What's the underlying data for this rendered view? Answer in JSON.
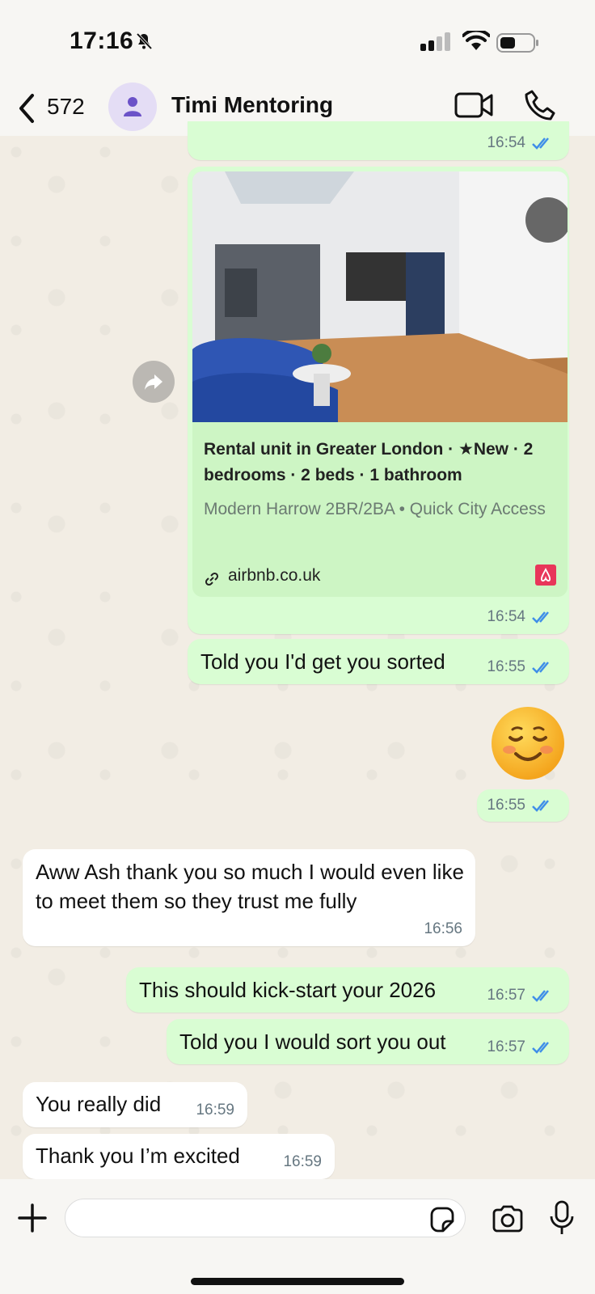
{
  "status_bar": {
    "time": "17:16"
  },
  "header": {
    "back_count": "572",
    "contact_name": "Timi Mentoring"
  },
  "messages": {
    "m0": {
      "time": "16:54"
    },
    "link": {
      "title": "Rental unit in Greater London · ★New · 2 bedrooms · 2 beds · 1 bathroom",
      "description": "Modern Harrow 2BR/2BA • Quick City Access",
      "domain": "airbnb.co.uk",
      "time": "16:54"
    },
    "m2": {
      "text": "Told you I'd get you sorted",
      "time": "16:55"
    },
    "m3": {
      "emoji": "☺️",
      "time": "16:55"
    },
    "m4": {
      "text": "Aww Ash thank you so much I would even like to meet them so they trust me fully",
      "time": "16:56"
    },
    "m5": {
      "text": "This should kick-start your 2026",
      "time": "16:57"
    },
    "m6": {
      "text": "Told you I would sort you out",
      "time": "16:57"
    },
    "m7": {
      "text": "You really did",
      "time": "16:59"
    },
    "m8": {
      "text": "Thank you I’m excited",
      "time": "16:59"
    }
  },
  "input": {
    "placeholder": ""
  },
  "colors": {
    "outgoing": "#d9fdd3",
    "incoming": "#ffffff",
    "tick_blue": "#3f8ee8",
    "airbnb": "#e8365a"
  }
}
